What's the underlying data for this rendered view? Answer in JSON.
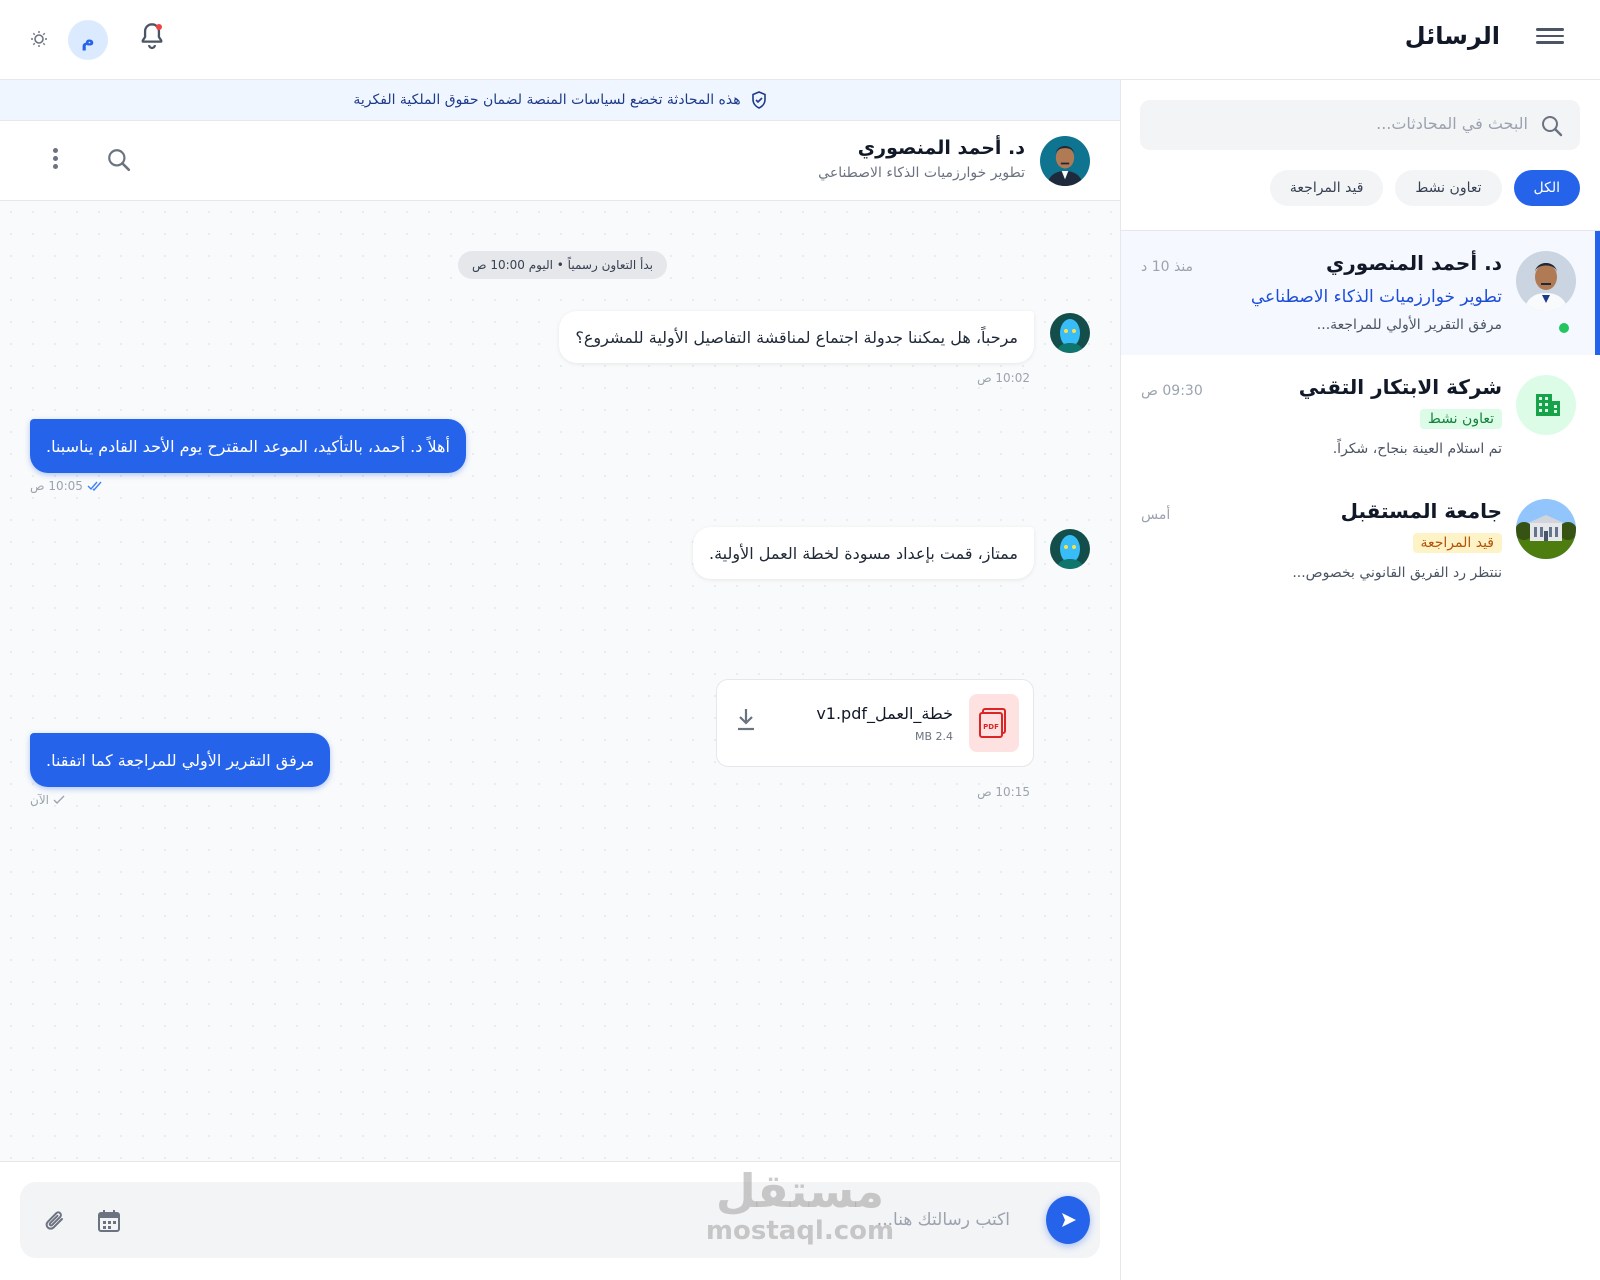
{
  "header": {
    "title": "الرسائل",
    "user_initial": "م"
  },
  "sidebar": {
    "search_placeholder": "البحث في المحادثات...",
    "filters": [
      {
        "label": "الكل",
        "active": true
      },
      {
        "label": "تعاون نشط",
        "active": false
      },
      {
        "label": "قيد المراجعة",
        "active": false
      }
    ],
    "conversations": [
      {
        "name": "د. أحمد المنصوري",
        "subtitle": "تطوير خوارزميات الذكاء الاصطناعي",
        "preview": "مرفق التقرير الأولي للمراجعة...",
        "time": "منذ 10 د",
        "online": true,
        "active": true
      },
      {
        "name": "شركة الابتكار التقني",
        "tag": "تعاون نشط",
        "tag_color": "#15803d",
        "preview": "تم استلام العينة بنجاح، شكراً.",
        "time": "09:30 ص",
        "icon": "building-icon"
      },
      {
        "name": "جامعة المستقبل",
        "tag": "قيد المراجعة",
        "tag_color": "#b45309",
        "preview": "ننتظر رد الفريق القانوني بخصوص...",
        "time": "أمس"
      }
    ]
  },
  "chat": {
    "notice": "هذه المحادثة تخضع لسياسات المنصة لضمان حقوق الملكية الفكرية",
    "contact_name": "د. أحمد المنصوري",
    "contact_subtitle": "تطوير خوارزميات الذكاء الاصطناعي",
    "system_message": "بدأ التعاون رسمياً • اليوم 10:00 ص",
    "messages": [
      {
        "direction": "in",
        "text": "مرحباً، هل يمكننا جدولة اجتماع لمناقشة التفاصيل الأولية للمشروع؟",
        "time": "10:02 ص"
      },
      {
        "direction": "out",
        "text": "أهلاً د. أحمد، بالتأكيد، الموعد المقترح يوم الأحد القادم يناسبنا.",
        "time": "10:05 ص",
        "status": "read"
      },
      {
        "direction": "in",
        "text": "ممتاز، قمت بإعداد مسودة لخطة العمل الأولية.",
        "time": "10:15 ص",
        "attachment": {
          "name": "خطة_العمل_v1.pdf",
          "size": "2.4 MB",
          "type": "PDF"
        }
      },
      {
        "direction": "out",
        "text": "مرفق التقرير الأولي للمراجعة كما اتفقنا.",
        "time": "الآن",
        "status": "sent"
      }
    ]
  },
  "composer": {
    "placeholder": "اكتب رسالتك هنا..."
  },
  "watermark": {
    "arabic": "مستقل",
    "latin": "mostaql.com"
  },
  "colors": {
    "accent": "#2563eb",
    "online": "#22c55e",
    "notification": "#ef4444"
  }
}
